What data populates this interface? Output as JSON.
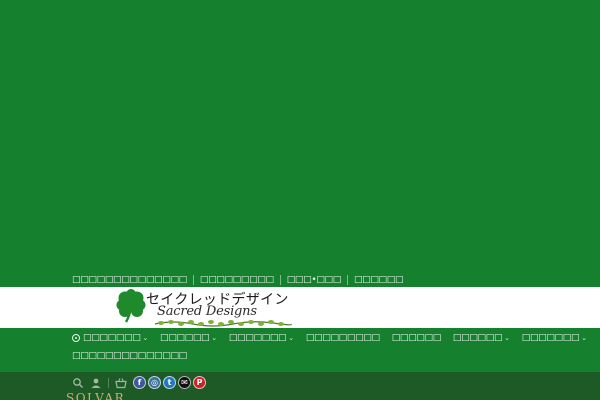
{
  "colors": {
    "background": "#15802d",
    "brand_bar": "#ffffff",
    "bottom_bar": "#1d5a26",
    "facebook": "#3b5998",
    "instagram": "#3f729b",
    "twitter": "#2478ba",
    "email": "#111111",
    "pinterest": "#cb2128",
    "brand_text": "#c9b277"
  },
  "top_nav": {
    "items": [
      {
        "label": "□□□□□□□□□□□□□□"
      },
      {
        "label": "□□□□□□□□□"
      },
      {
        "label": "□□□•□□□"
      },
      {
        "label": "□□□□□□"
      }
    ]
  },
  "logo": {
    "jp_text": "セイクレッドデザイン",
    "en_text": "Sacred Designs",
    "icon": "four-leaf-clover-icon"
  },
  "main_nav": {
    "row1": [
      {
        "label": "□□□□□□□",
        "icon": "home-icon",
        "has_dropdown": true
      },
      {
        "label": "□□□□□□",
        "has_dropdown": true
      },
      {
        "label": "□□□□□□□",
        "has_dropdown": true
      },
      {
        "label": "□□□□□□□□□",
        "has_dropdown": false
      },
      {
        "label": "□□□□□□",
        "has_dropdown": false
      },
      {
        "label": "□□□□□□",
        "has_dropdown": true
      },
      {
        "label": "□□□□□□□",
        "has_dropdown": true
      }
    ],
    "row2": [
      {
        "label": "□□□□□□□□□□□□□□",
        "has_dropdown": false
      }
    ]
  },
  "bottom_bar": {
    "tools": [
      "search-icon",
      "user-icon",
      "basket-icon"
    ],
    "social": [
      {
        "name": "facebook-icon",
        "glyph": "f"
      },
      {
        "name": "instagram-icon",
        "glyph": "◎"
      },
      {
        "name": "twitter-icon",
        "glyph": "t"
      },
      {
        "name": "email-icon",
        "glyph": "✉"
      },
      {
        "name": "pinterest-icon",
        "glyph": "P"
      }
    ],
    "brand_text": "SOLVAR"
  },
  "dropdown_glyph": "⌄"
}
